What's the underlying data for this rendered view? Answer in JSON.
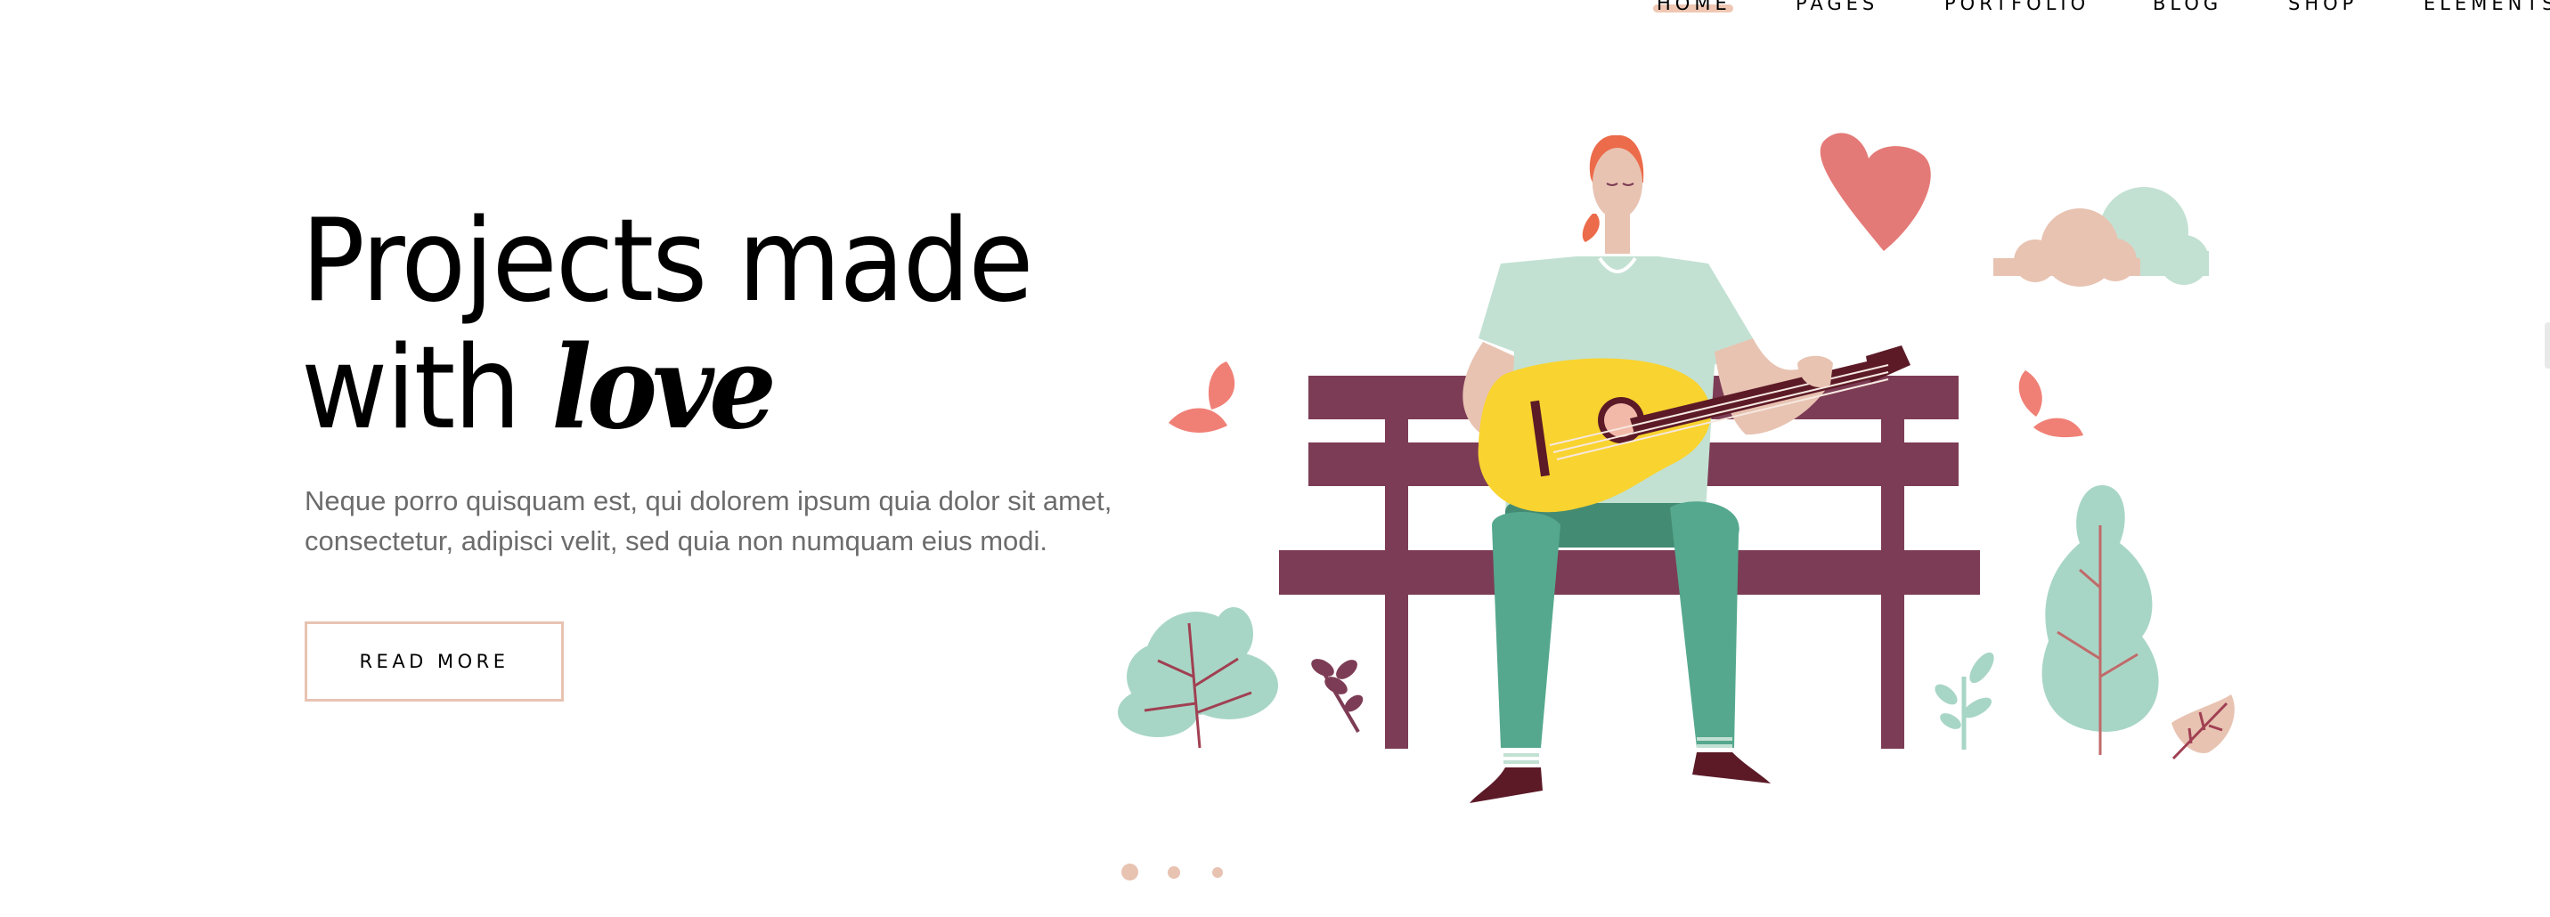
{
  "nav": {
    "items": [
      {
        "label": "HOME",
        "active": true
      },
      {
        "label": "PAGES",
        "active": false
      },
      {
        "label": "PORTFOLIO",
        "active": false
      },
      {
        "label": "BLOG",
        "active": false
      },
      {
        "label": "SHOP",
        "active": false
      },
      {
        "label": "ELEMENTS",
        "active": false
      }
    ]
  },
  "hero": {
    "title_line1": "Projects made",
    "title_line2_prefix": "with ",
    "title_line2_emphasis": "love",
    "description_line1": "Neque porro quisquam est, qui dolorem ipsum quia dolor sit amet,",
    "description_line2": "consectetur, adipisci velit, sed quia non numquam eius modi.",
    "cta_label": "READ MORE"
  },
  "slider": {
    "slide_count": 3,
    "active_index": 0
  },
  "colors": {
    "accent": "#e8c3b2",
    "bench": "#7d3c55",
    "shirt": "#c2e1d3",
    "pants": "#55a88e",
    "guitar": "#f9d32f",
    "hair": "#ec6b4a",
    "heart": "#e47a77",
    "text_muted": "#6c6c6c"
  },
  "illustration": {
    "icon": "man-playing-guitar-on-bench-illustration"
  }
}
